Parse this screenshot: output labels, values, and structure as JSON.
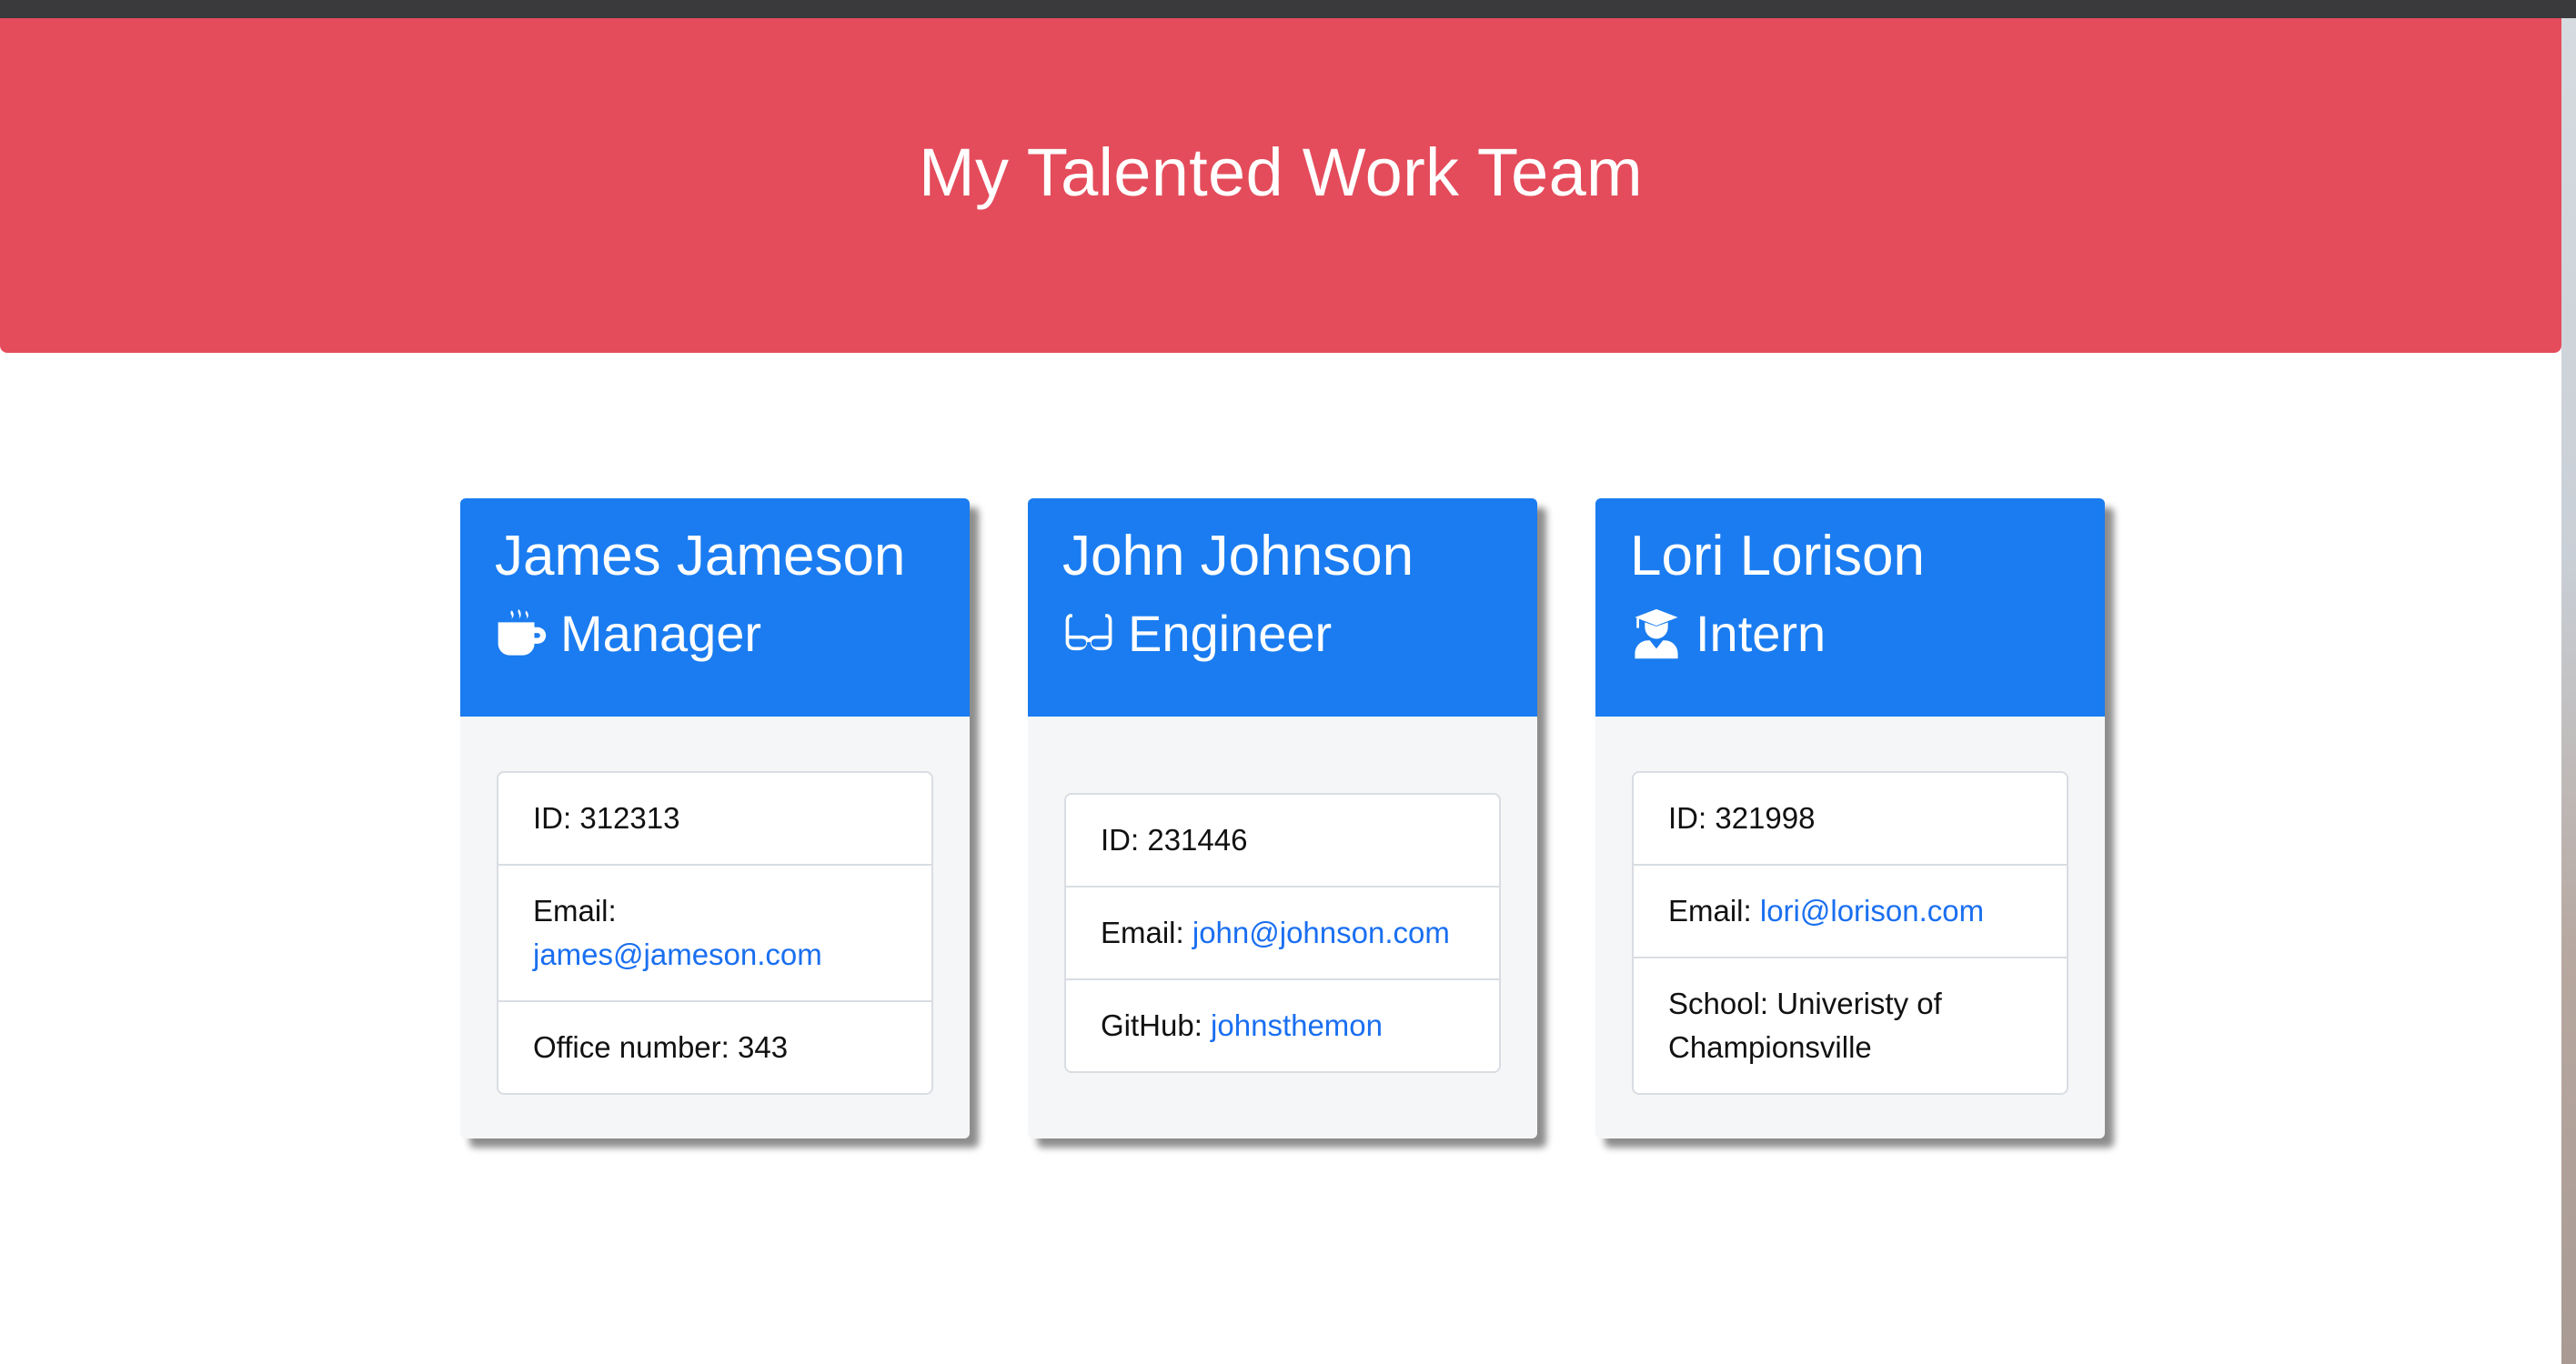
{
  "header": {
    "title": "My Talented Work Team"
  },
  "colors": {
    "banner": "#e44c5b",
    "card_header": "#1a7cf0",
    "link": "#1a6ff0"
  },
  "cards": [
    {
      "name": "James Jameson",
      "role": "Manager",
      "role_icon": "coffee-mug-icon",
      "id_text": "ID: 312313",
      "email_label": "Email:",
      "email": "james@jameson.com",
      "extra_label": "Office number: 343",
      "extra_link": ""
    },
    {
      "name": "John Johnson",
      "role": "Engineer",
      "role_icon": "glasses-icon",
      "id_text": "ID: 231446",
      "email_label": "Email:",
      "email": "john@johnson.com",
      "extra_label": "GitHub:",
      "extra_link": "johnsthemon"
    },
    {
      "name": "Lori Lorison",
      "role": "Intern",
      "role_icon": "graduate-icon",
      "id_text": "ID: 321998",
      "email_label": "Email:",
      "email": "lori@lorison.com",
      "extra_label": "School: Univeristy of Championsville",
      "extra_link": ""
    }
  ]
}
